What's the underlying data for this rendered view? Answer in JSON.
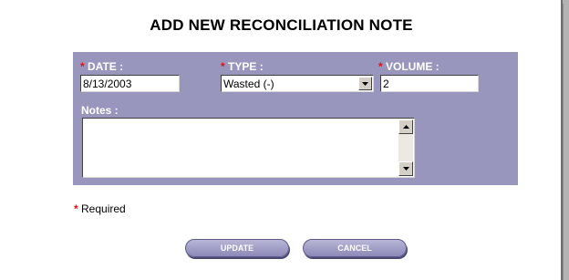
{
  "dialog": {
    "title": "ADD NEW RECONCILIATION NOTE"
  },
  "form": {
    "required_marker": "*",
    "date": {
      "label": "DATE :",
      "value": "8/13/2003"
    },
    "type": {
      "label": "TYPE :",
      "selected": "Wasted (-)"
    },
    "volume": {
      "label": "VOLUME :",
      "value": "2"
    },
    "notes": {
      "label": "Notes :",
      "value": ""
    }
  },
  "footer": {
    "required_text": "Required",
    "update_label": "UPDATE",
    "cancel_label": "CANCEL"
  },
  "icons": {
    "select_arrow": "chevron-down-icon",
    "scroll_up": "scroll-up-arrow-icon",
    "scroll_down": "scroll-down-arrow-icon"
  },
  "colors": {
    "panel": "#9896bd",
    "required": "#e01010",
    "button": "#9e9cc8"
  }
}
